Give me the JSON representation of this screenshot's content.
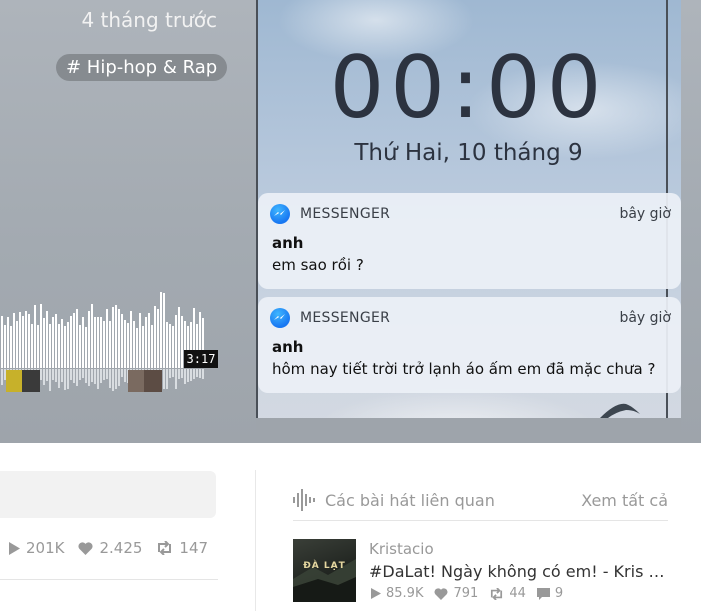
{
  "hero": {
    "time_ago": "4 tháng trước",
    "genre_tag": "# Hip-hop & Rap",
    "duration": "3:17"
  },
  "artwork": {
    "clock": "00:00",
    "date": "Thứ Hai, 10 tháng 9",
    "notifications": [
      {
        "app": "MESSENGER",
        "when": "bây giờ",
        "sender": "anh",
        "message": "em sao rồi ?"
      },
      {
        "app": "MESSENGER",
        "when": "bây giờ",
        "sender": "anh",
        "message": "hôm nay tiết trời trở lạnh áo ấm em đã mặc chưa ?"
      }
    ]
  },
  "track_stats": {
    "plays": "201K",
    "likes": "2.425",
    "reposts": "147"
  },
  "related": {
    "title": "Các bài hát liên quan",
    "see_all": "Xem tất cả",
    "items": [
      {
        "artist": "Kristacio",
        "title": "#DaLat! Ngày không có em! - Kris X...",
        "thumb_text": "ĐÀ LẠT",
        "plays": "85.9K",
        "likes": "791",
        "reposts": "44",
        "comments": "9"
      }
    ]
  },
  "icons": {
    "play": "play-icon",
    "heart": "heart-icon",
    "repost": "repost-icon",
    "comment": "comment-icon",
    "waveform": "waveform-icon",
    "messenger": "messenger-icon"
  },
  "colors": {
    "hero_bg": "#a3aab1",
    "tag_bg": "#868b90",
    "muted_text": "#999999",
    "divider": "#e5e5e5"
  }
}
